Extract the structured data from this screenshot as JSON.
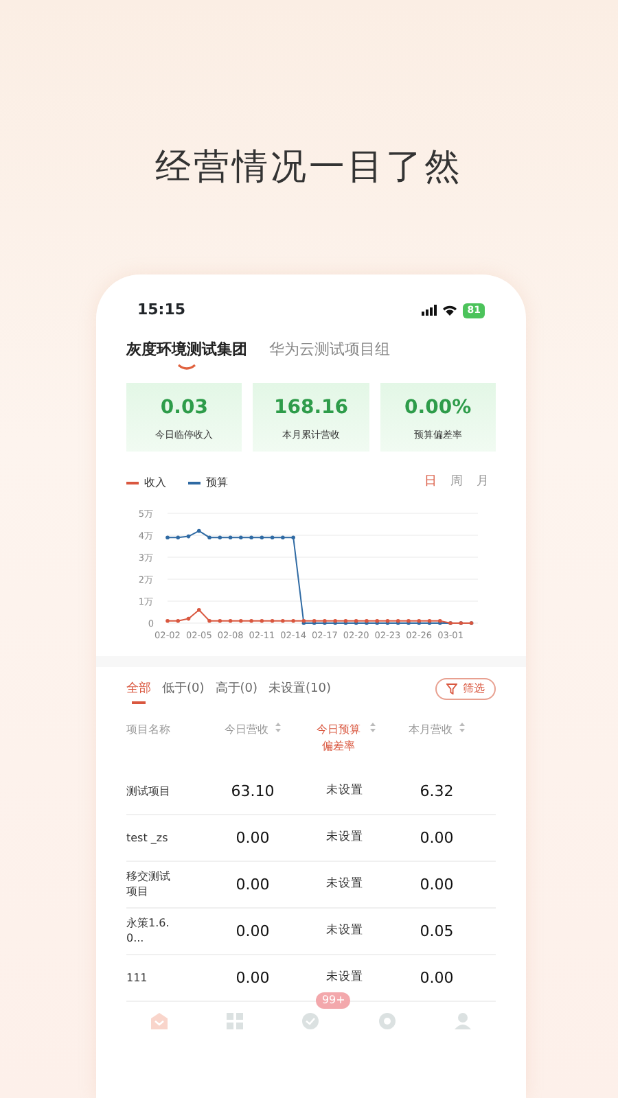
{
  "headline": "经营情况一目了然",
  "status_bar": {
    "time": "15:15",
    "battery": "81"
  },
  "org_tabs": [
    {
      "label": "灰度环境测试集团",
      "selected": true
    },
    {
      "label": "华为云测试项目组",
      "selected": false
    }
  ],
  "stats": [
    {
      "value": "0.03",
      "label": "今日临停收入"
    },
    {
      "value": "168.16",
      "label": "本月累计营收"
    },
    {
      "value": "0.00%",
      "label": "预算偏差率"
    }
  ],
  "period_tabs": [
    {
      "label": "日",
      "selected": true
    },
    {
      "label": "周",
      "selected": false
    },
    {
      "label": "月",
      "selected": false
    }
  ],
  "chart_data": {
    "type": "line",
    "grid": true,
    "categories": [
      "02-02",
      null,
      null,
      "02-05",
      null,
      null,
      "02-08",
      null,
      null,
      "02-11",
      null,
      null,
      "02-14",
      null,
      null,
      "02-17",
      null,
      null,
      "02-20",
      null,
      null,
      "02-23",
      null,
      null,
      "02-26",
      null,
      null,
      "03-01",
      null,
      null
    ],
    "series": [
      {
        "name": "收入",
        "color": "#d9573f",
        "values": [
          0.1,
          0.1,
          0.2,
          0.6,
          0.1,
          0.1,
          0.1,
          0.1,
          0.1,
          0.1,
          0.1,
          0.1,
          0.1,
          0.1,
          0.1,
          0.1,
          0.1,
          0.1,
          0.1,
          0.1,
          0.1,
          0.1,
          0.1,
          0.1,
          0.1,
          0.1,
          0.1,
          0,
          0,
          0
        ]
      },
      {
        "name": "预算",
        "color": "#2f6aa3",
        "values": [
          3.9,
          3.9,
          3.95,
          4.2,
          3.9,
          3.9,
          3.9,
          3.9,
          3.9,
          3.9,
          3.9,
          3.9,
          3.9,
          0,
          0,
          0,
          0,
          0,
          0,
          0,
          0,
          0,
          0,
          0,
          0,
          0,
          0,
          0,
          0,
          0
        ]
      }
    ],
    "yticks": [
      {
        "value": 0,
        "label": "0"
      },
      {
        "value": 1,
        "label": "1万"
      },
      {
        "value": 2,
        "label": "2万"
      },
      {
        "value": 3,
        "label": "3万"
      },
      {
        "value": 4,
        "label": "4万"
      },
      {
        "value": 5,
        "label": "5万"
      }
    ],
    "ylim": [
      0,
      5
    ]
  },
  "filter_tabs": [
    {
      "label": "全部",
      "selected": true
    },
    {
      "label": "低于(0)",
      "selected": false
    },
    {
      "label": "高于(0)",
      "selected": false
    },
    {
      "label": "未设置(10)",
      "selected": false
    }
  ],
  "filter_button": "筛选",
  "table": {
    "columns": [
      {
        "label": "项目名称",
        "sortable": false,
        "selected": false
      },
      {
        "label": "今日营收",
        "sortable": true,
        "selected": false
      },
      {
        "label": "今日预算偏差率",
        "sortable": true,
        "selected": true
      },
      {
        "label": "本月营收",
        "sortable": true,
        "selected": false
      }
    ],
    "rows": [
      [
        "测试项目",
        "63.10",
        "未设置",
        "6.32"
      ],
      [
        "test _zs",
        "0.00",
        "未设置",
        "0.00"
      ],
      [
        "移交测试项目",
        "0.00",
        "未设置",
        "0.00"
      ],
      [
        "永策1.6.0...",
        "0.00",
        "未设置",
        "0.05"
      ],
      [
        "111",
        "0.00",
        "未设置",
        "0.00"
      ]
    ]
  },
  "bottom_nav": {
    "badge": "99+"
  }
}
